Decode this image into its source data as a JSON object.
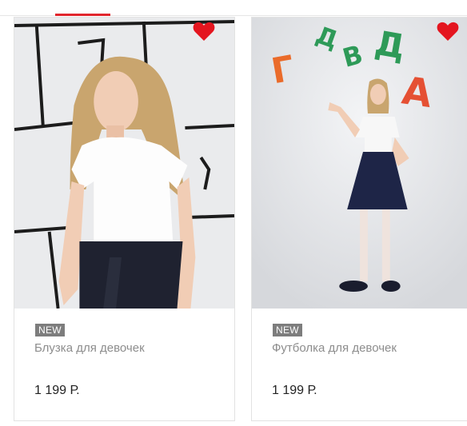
{
  "colors": {
    "accent": "#e1262d",
    "favorite": "#e4151f",
    "badge": "#7d7d7d"
  },
  "products": [
    {
      "badge": "NEW",
      "name": "Блузка для девочек",
      "price": "1 199 Р.",
      "favorite_icon": "heart-icon"
    },
    {
      "badge": "NEW",
      "name": "Футболка для девочек",
      "price": "1 199 Р.",
      "favorite_icon": "heart-icon"
    }
  ],
  "photo2_letters": [
    "Г",
    "Д",
    "В",
    "Д",
    "А"
  ]
}
